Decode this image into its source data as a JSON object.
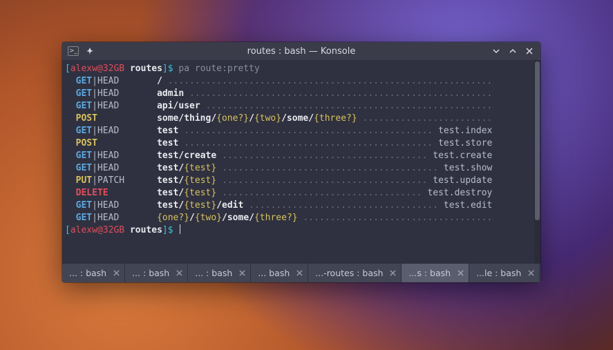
{
  "window": {
    "title": "routes : bash — Konsole"
  },
  "prompt": {
    "bracket_open": "[",
    "user_host": "alexw@32GB",
    "dir": "routes",
    "bracket_close": "]$ ",
    "command": "pa route:pretty"
  },
  "routes": [
    {
      "method": "GET",
      "alt": "HEAD",
      "uri": [
        {
          "t": "/",
          "p": false
        }
      ],
      "name": ""
    },
    {
      "method": "GET",
      "alt": "HEAD",
      "uri": [
        {
          "t": "admin",
          "p": false
        }
      ],
      "name": ""
    },
    {
      "method": "GET",
      "alt": "HEAD",
      "uri": [
        {
          "t": "api/user",
          "p": false
        }
      ],
      "name": ""
    },
    {
      "method": "POST",
      "alt": "",
      "uri": [
        {
          "t": "some/thing/",
          "p": false
        },
        {
          "t": "{one?}",
          "p": true
        },
        {
          "t": "/",
          "p": false
        },
        {
          "t": "{two}",
          "p": true
        },
        {
          "t": "/some/",
          "p": false
        },
        {
          "t": "{three?}",
          "p": true
        }
      ],
      "name": ""
    },
    {
      "method": "GET",
      "alt": "HEAD",
      "uri": [
        {
          "t": "test",
          "p": false
        }
      ],
      "name": "test.index"
    },
    {
      "method": "POST",
      "alt": "",
      "uri": [
        {
          "t": "test",
          "p": false
        }
      ],
      "name": "test.store"
    },
    {
      "method": "GET",
      "alt": "HEAD",
      "uri": [
        {
          "t": "test/create",
          "p": false
        }
      ],
      "name": "test.create"
    },
    {
      "method": "GET",
      "alt": "HEAD",
      "uri": [
        {
          "t": "test/",
          "p": false
        },
        {
          "t": "{test}",
          "p": true
        }
      ],
      "name": "test.show"
    },
    {
      "method": "PUT",
      "alt": "PATCH",
      "uri": [
        {
          "t": "test/",
          "p": false
        },
        {
          "t": "{test}",
          "p": true
        }
      ],
      "name": "test.update"
    },
    {
      "method": "DELETE",
      "alt": "",
      "uri": [
        {
          "t": "test/",
          "p": false
        },
        {
          "t": "{test}",
          "p": true
        }
      ],
      "name": "test.destroy"
    },
    {
      "method": "GET",
      "alt": "HEAD",
      "uri": [
        {
          "t": "test/",
          "p": false
        },
        {
          "t": "{test}",
          "p": true
        },
        {
          "t": "/edit",
          "p": false
        }
      ],
      "name": "test.edit"
    },
    {
      "method": "GET",
      "alt": "HEAD",
      "uri": [
        {
          "t": "{one?}",
          "p": true
        },
        {
          "t": "/",
          "p": false
        },
        {
          "t": "{two}",
          "p": true
        },
        {
          "t": "/some/",
          "p": false
        },
        {
          "t": "{three?}",
          "p": true
        }
      ],
      "name": ""
    }
  ],
  "layout": {
    "method_col_width": 15,
    "total_line_width": 79
  },
  "tabs": [
    {
      "label": "... : bash",
      "active": false
    },
    {
      "label": "... : bash",
      "active": false
    },
    {
      "label": "... : bash",
      "active": false
    },
    {
      "label": "... bash",
      "active": false
    },
    {
      "label": "...-routes : bash",
      "active": false
    },
    {
      "label": "...s : bash",
      "active": true
    },
    {
      "label": "...le : bash",
      "active": false
    }
  ]
}
